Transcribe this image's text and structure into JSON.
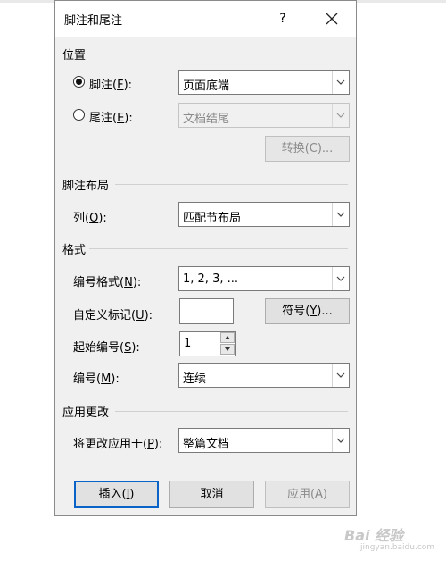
{
  "dialog": {
    "title": "脚注和尾注",
    "help": "?",
    "close_icon": "close-icon"
  },
  "location": {
    "heading": "位置",
    "footnote": {
      "label_pre": "脚注(",
      "mnemonic": "F",
      "label_post": "):",
      "value": "页面底端",
      "selected": true
    },
    "endnote": {
      "label_pre": "尾注(",
      "mnemonic": "E",
      "label_post": "):",
      "value": "文档结尾",
      "selected": false
    },
    "convert_button": "转换(C)..."
  },
  "layout": {
    "heading": "脚注布局",
    "columns": {
      "label_pre": "列(",
      "mnemonic": "O",
      "label_post": "):",
      "value": "匹配节布局"
    }
  },
  "format": {
    "heading": "格式",
    "number_format": {
      "label_pre": "编号格式(",
      "mnemonic": "N",
      "label_post": "):",
      "value": "1, 2, 3, ..."
    },
    "custom_mark": {
      "label_pre": "自定义标记(",
      "mnemonic": "U",
      "label_post": "):",
      "value": ""
    },
    "symbol_button": {
      "pre": "符号(",
      "mnemonic": "Y",
      "post": ")..."
    },
    "start_at": {
      "label_pre": "起始编号(",
      "mnemonic": "S",
      "label_post": "):",
      "value": "1"
    },
    "numbering": {
      "label_pre": "编号(",
      "mnemonic": "M",
      "label_post": "):",
      "value": "连续"
    }
  },
  "apply": {
    "heading": "应用更改",
    "apply_to": {
      "label_pre": "将更改应用于(",
      "mnemonic": "P",
      "label_post": "):",
      "value": "整篇文档"
    }
  },
  "buttons": {
    "insert": {
      "pre": "插入(",
      "mnemonic": "I",
      "post": ")"
    },
    "cancel": "取消",
    "apply": "应用(A)"
  },
  "watermark": {
    "main": "Bai 经验",
    "sub": "jingyan.baidu.com"
  }
}
